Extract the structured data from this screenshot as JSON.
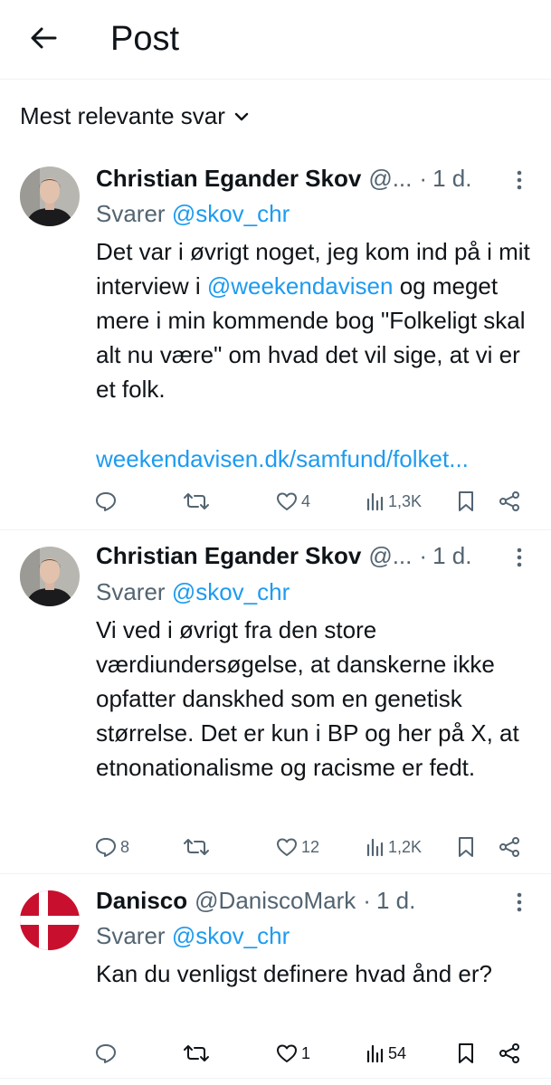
{
  "header": {
    "back_icon": "arrow-left-icon",
    "title": "Post"
  },
  "sort": {
    "label": "Mest relevante svar",
    "chevron_icon": "chevron-down-icon"
  },
  "colors": {
    "link": "#1d9bf0",
    "secondary_text": "#536471",
    "primary_text": "#0f1419",
    "divider": "#eff3f4"
  },
  "replies": [
    {
      "name": "Christian Egander Skov",
      "handle": "@...",
      "dot": "·",
      "time": "1 d.",
      "replying_prefix": "Svarer",
      "replying_to": "@skov_chr",
      "text_parts": [
        "Det var i øvrigt noget, jeg kom ind på i mit interview i ",
        "@weekendavisen",
        " og meget mere i min kommende bog \"Folkeligt skal alt nu være\" om hvad det vil sige, at vi er et folk."
      ],
      "link": "weekendavisen.dk/samfund/folket...",
      "actions": {
        "replies": "",
        "reposts": "",
        "likes": "4",
        "views": "1,3K"
      }
    },
    {
      "name": "Christian Egander Skov",
      "handle": "@...",
      "dot": "·",
      "time": "1 d.",
      "replying_prefix": "Svarer",
      "replying_to": "@skov_chr",
      "text": "Vi ved i øvrigt fra den store værdiundersøgelse, at danskerne ikke opfatter danskhed som en genetisk størrelse. Det er kun i BP og her på X, at etnonationalisme og racisme er fedt.",
      "actions": {
        "replies": "8",
        "reposts": "",
        "likes": "12",
        "views": "1,2K"
      }
    },
    {
      "name": "Danisco",
      "handle": "@DaniscoMark",
      "dot": "·",
      "time": "1 d.",
      "replying_prefix": "Svarer",
      "replying_to": "@skov_chr",
      "text": "Kan du venligst definere hvad ånd er?",
      "actions": {
        "replies": "",
        "reposts": "",
        "likes": "1",
        "views": "54"
      }
    }
  ]
}
